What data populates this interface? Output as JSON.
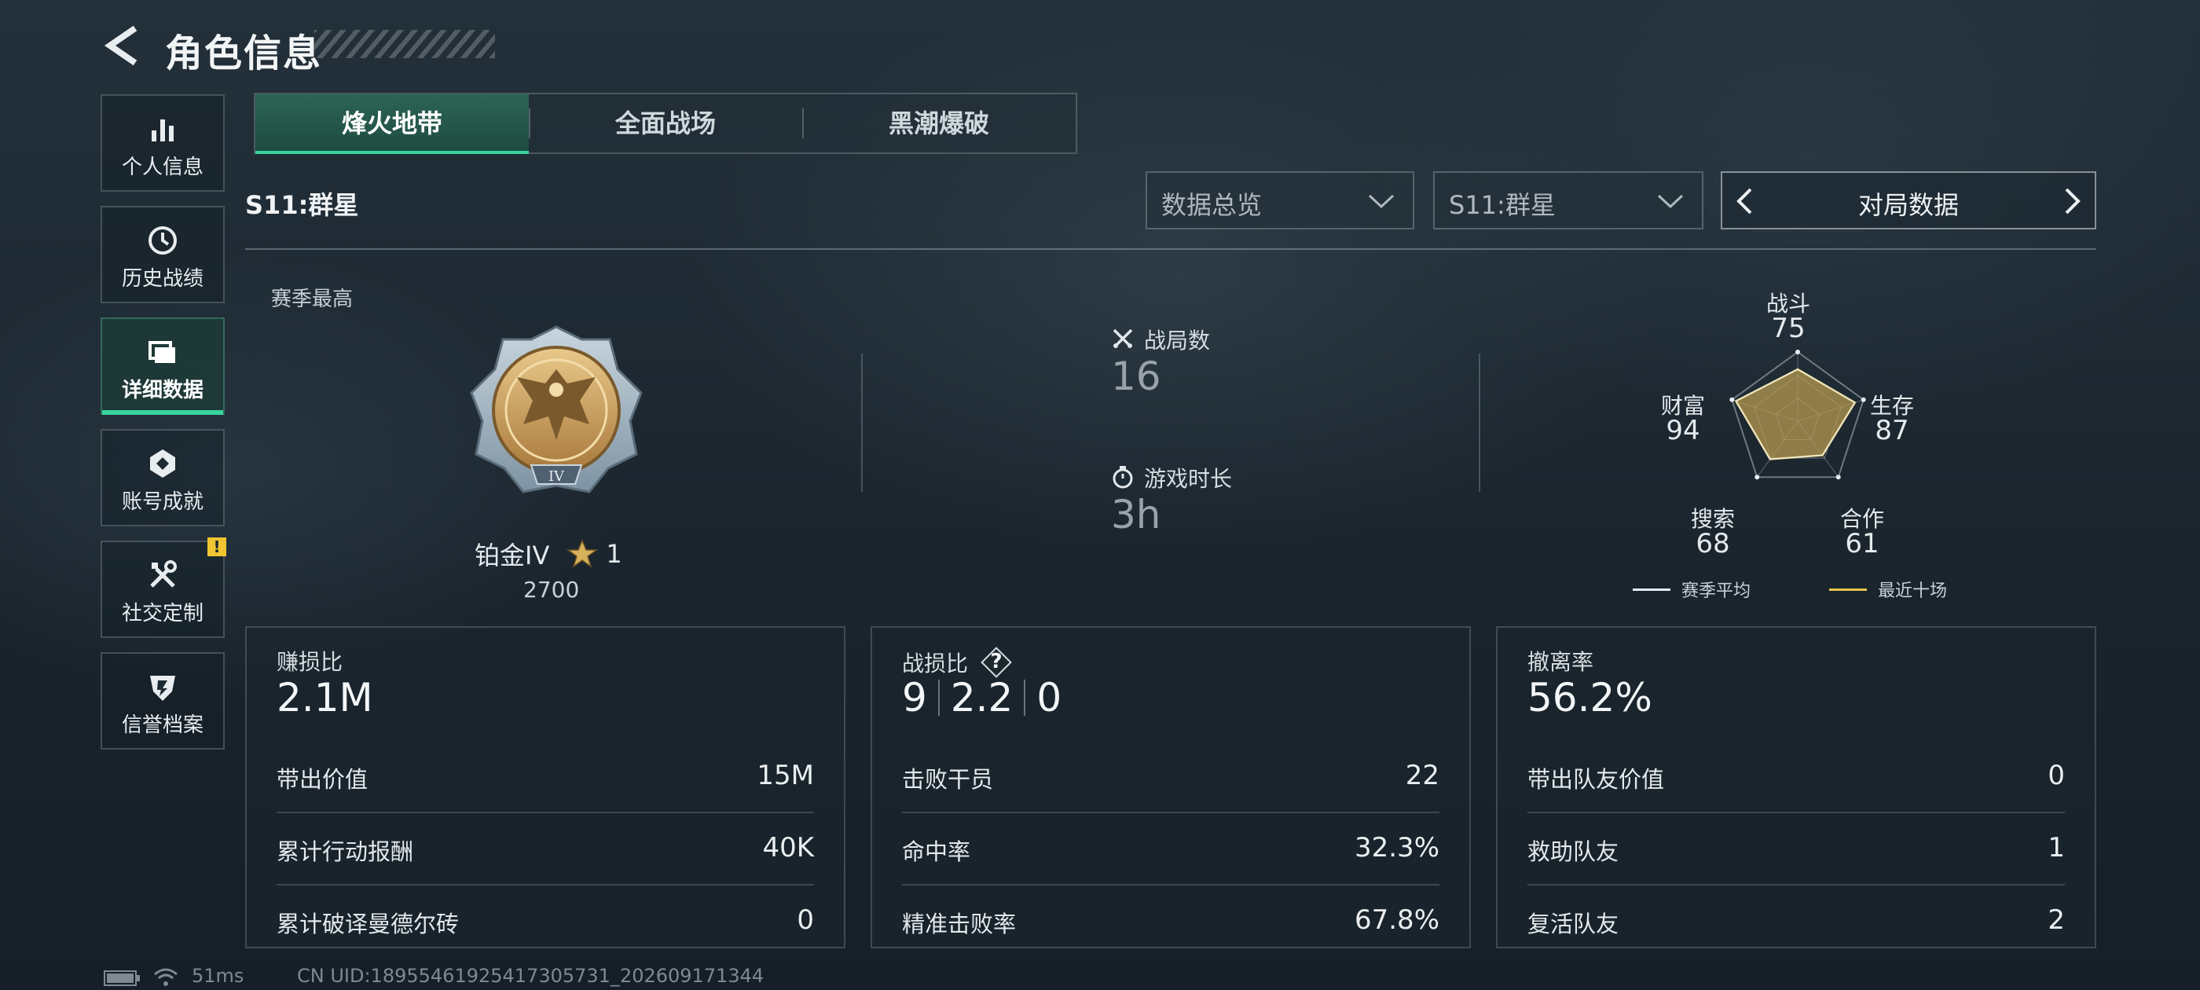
{
  "header": {
    "title": "角色信息"
  },
  "sidebar": {
    "items": [
      {
        "label": "个人信息",
        "icon": "bar-chart-icon"
      },
      {
        "label": "历史战绩",
        "icon": "clock-icon"
      },
      {
        "label": "详细数据",
        "icon": "folder-icon",
        "active": true
      },
      {
        "label": "账号成就",
        "icon": "achievement-icon"
      },
      {
        "label": "社交定制",
        "icon": "tools-icon",
        "badge": "!"
      },
      {
        "label": "信誉档案",
        "icon": "shield-icon"
      }
    ]
  },
  "tabs": [
    {
      "label": "烽火地带",
      "active": true
    },
    {
      "label": "全面战场"
    },
    {
      "label": "黑潮爆破"
    }
  ],
  "season": {
    "title": "S11:群星"
  },
  "filters": {
    "category": "数据总览",
    "season": "S11:群星",
    "pager_label": "对局数据"
  },
  "overview": {
    "season_best_label": "赛季最高",
    "rank_name": "铂金IV",
    "rank_emblem_numeral": "IV",
    "stars": "1",
    "score": "2700",
    "matches_label": "战局数",
    "matches_value": "16",
    "playtime_label": "游戏时长",
    "playtime_value": "3h"
  },
  "radar": {
    "axes": [
      {
        "label": "战斗",
        "value": 75
      },
      {
        "label": "生存",
        "value": 87
      },
      {
        "label": "合作",
        "value": 61
      },
      {
        "label": "搜索",
        "value": 68
      },
      {
        "label": "财富",
        "value": 94
      }
    ],
    "legend_season": "赛季平均",
    "legend_recent": "最近十场",
    "colors": {
      "season": "#e6ecef",
      "recent": "#e8c34a",
      "fill": "#b59a52"
    }
  },
  "cards": [
    {
      "title": "赚损比",
      "value": "2.1M",
      "rows": [
        {
          "label": "带出价值",
          "value": "15M"
        },
        {
          "label": "累计行动报酬",
          "value": "40K"
        },
        {
          "label": "累计破译曼德尔砖",
          "value": "0"
        }
      ]
    },
    {
      "title": "战损比",
      "help": "?",
      "kda": [
        "9",
        "2.2",
        "0"
      ],
      "rows": [
        {
          "label": "击败干员",
          "value": "22"
        },
        {
          "label": "命中率",
          "value": "32.3%"
        },
        {
          "label": "精准击败率",
          "value": "67.8%"
        }
      ]
    },
    {
      "title": "撤离率",
      "value": "56.2%",
      "rows": [
        {
          "label": "带出队友价值",
          "value": "0"
        },
        {
          "label": "救助队友",
          "value": "1"
        },
        {
          "label": "复活队友",
          "value": "2"
        }
      ]
    }
  ],
  "footer": {
    "ping": "51ms",
    "uid": "CN UID:18955461925417305731_202609171344"
  },
  "accent": "#39d39d"
}
